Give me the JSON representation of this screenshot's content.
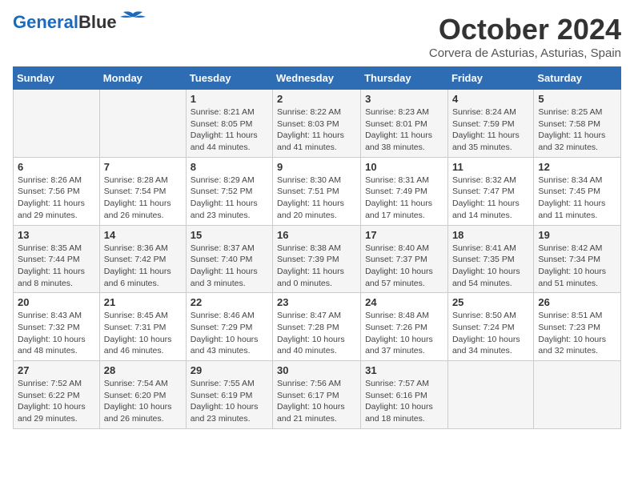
{
  "header": {
    "logo_line1": "General",
    "logo_line2": "Blue",
    "month": "October 2024",
    "location": "Corvera de Asturias, Asturias, Spain"
  },
  "days_of_week": [
    "Sunday",
    "Monday",
    "Tuesday",
    "Wednesday",
    "Thursday",
    "Friday",
    "Saturday"
  ],
  "weeks": [
    [
      {
        "day": "",
        "sunrise": "",
        "sunset": "",
        "daylight": ""
      },
      {
        "day": "",
        "sunrise": "",
        "sunset": "",
        "daylight": ""
      },
      {
        "day": "1",
        "sunrise": "Sunrise: 8:21 AM",
        "sunset": "Sunset: 8:05 PM",
        "daylight": "Daylight: 11 hours and 44 minutes."
      },
      {
        "day": "2",
        "sunrise": "Sunrise: 8:22 AM",
        "sunset": "Sunset: 8:03 PM",
        "daylight": "Daylight: 11 hours and 41 minutes."
      },
      {
        "day": "3",
        "sunrise": "Sunrise: 8:23 AM",
        "sunset": "Sunset: 8:01 PM",
        "daylight": "Daylight: 11 hours and 38 minutes."
      },
      {
        "day": "4",
        "sunrise": "Sunrise: 8:24 AM",
        "sunset": "Sunset: 7:59 PM",
        "daylight": "Daylight: 11 hours and 35 minutes."
      },
      {
        "day": "5",
        "sunrise": "Sunrise: 8:25 AM",
        "sunset": "Sunset: 7:58 PM",
        "daylight": "Daylight: 11 hours and 32 minutes."
      }
    ],
    [
      {
        "day": "6",
        "sunrise": "Sunrise: 8:26 AM",
        "sunset": "Sunset: 7:56 PM",
        "daylight": "Daylight: 11 hours and 29 minutes."
      },
      {
        "day": "7",
        "sunrise": "Sunrise: 8:28 AM",
        "sunset": "Sunset: 7:54 PM",
        "daylight": "Daylight: 11 hours and 26 minutes."
      },
      {
        "day": "8",
        "sunrise": "Sunrise: 8:29 AM",
        "sunset": "Sunset: 7:52 PM",
        "daylight": "Daylight: 11 hours and 23 minutes."
      },
      {
        "day": "9",
        "sunrise": "Sunrise: 8:30 AM",
        "sunset": "Sunset: 7:51 PM",
        "daylight": "Daylight: 11 hours and 20 minutes."
      },
      {
        "day": "10",
        "sunrise": "Sunrise: 8:31 AM",
        "sunset": "Sunset: 7:49 PM",
        "daylight": "Daylight: 11 hours and 17 minutes."
      },
      {
        "day": "11",
        "sunrise": "Sunrise: 8:32 AM",
        "sunset": "Sunset: 7:47 PM",
        "daylight": "Daylight: 11 hours and 14 minutes."
      },
      {
        "day": "12",
        "sunrise": "Sunrise: 8:34 AM",
        "sunset": "Sunset: 7:45 PM",
        "daylight": "Daylight: 11 hours and 11 minutes."
      }
    ],
    [
      {
        "day": "13",
        "sunrise": "Sunrise: 8:35 AM",
        "sunset": "Sunset: 7:44 PM",
        "daylight": "Daylight: 11 hours and 8 minutes."
      },
      {
        "day": "14",
        "sunrise": "Sunrise: 8:36 AM",
        "sunset": "Sunset: 7:42 PM",
        "daylight": "Daylight: 11 hours and 6 minutes."
      },
      {
        "day": "15",
        "sunrise": "Sunrise: 8:37 AM",
        "sunset": "Sunset: 7:40 PM",
        "daylight": "Daylight: 11 hours and 3 minutes."
      },
      {
        "day": "16",
        "sunrise": "Sunrise: 8:38 AM",
        "sunset": "Sunset: 7:39 PM",
        "daylight": "Daylight: 11 hours and 0 minutes."
      },
      {
        "day": "17",
        "sunrise": "Sunrise: 8:40 AM",
        "sunset": "Sunset: 7:37 PM",
        "daylight": "Daylight: 10 hours and 57 minutes."
      },
      {
        "day": "18",
        "sunrise": "Sunrise: 8:41 AM",
        "sunset": "Sunset: 7:35 PM",
        "daylight": "Daylight: 10 hours and 54 minutes."
      },
      {
        "day": "19",
        "sunrise": "Sunrise: 8:42 AM",
        "sunset": "Sunset: 7:34 PM",
        "daylight": "Daylight: 10 hours and 51 minutes."
      }
    ],
    [
      {
        "day": "20",
        "sunrise": "Sunrise: 8:43 AM",
        "sunset": "Sunset: 7:32 PM",
        "daylight": "Daylight: 10 hours and 48 minutes."
      },
      {
        "day": "21",
        "sunrise": "Sunrise: 8:45 AM",
        "sunset": "Sunset: 7:31 PM",
        "daylight": "Daylight: 10 hours and 46 minutes."
      },
      {
        "day": "22",
        "sunrise": "Sunrise: 8:46 AM",
        "sunset": "Sunset: 7:29 PM",
        "daylight": "Daylight: 10 hours and 43 minutes."
      },
      {
        "day": "23",
        "sunrise": "Sunrise: 8:47 AM",
        "sunset": "Sunset: 7:28 PM",
        "daylight": "Daylight: 10 hours and 40 minutes."
      },
      {
        "day": "24",
        "sunrise": "Sunrise: 8:48 AM",
        "sunset": "Sunset: 7:26 PM",
        "daylight": "Daylight: 10 hours and 37 minutes."
      },
      {
        "day": "25",
        "sunrise": "Sunrise: 8:50 AM",
        "sunset": "Sunset: 7:24 PM",
        "daylight": "Daylight: 10 hours and 34 minutes."
      },
      {
        "day": "26",
        "sunrise": "Sunrise: 8:51 AM",
        "sunset": "Sunset: 7:23 PM",
        "daylight": "Daylight: 10 hours and 32 minutes."
      }
    ],
    [
      {
        "day": "27",
        "sunrise": "Sunrise: 7:52 AM",
        "sunset": "Sunset: 6:22 PM",
        "daylight": "Daylight: 10 hours and 29 minutes."
      },
      {
        "day": "28",
        "sunrise": "Sunrise: 7:54 AM",
        "sunset": "Sunset: 6:20 PM",
        "daylight": "Daylight: 10 hours and 26 minutes."
      },
      {
        "day": "29",
        "sunrise": "Sunrise: 7:55 AM",
        "sunset": "Sunset: 6:19 PM",
        "daylight": "Daylight: 10 hours and 23 minutes."
      },
      {
        "day": "30",
        "sunrise": "Sunrise: 7:56 AM",
        "sunset": "Sunset: 6:17 PM",
        "daylight": "Daylight: 10 hours and 21 minutes."
      },
      {
        "day": "31",
        "sunrise": "Sunrise: 7:57 AM",
        "sunset": "Sunset: 6:16 PM",
        "daylight": "Daylight: 10 hours and 18 minutes."
      },
      {
        "day": "",
        "sunrise": "",
        "sunset": "",
        "daylight": ""
      },
      {
        "day": "",
        "sunrise": "",
        "sunset": "",
        "daylight": ""
      }
    ]
  ]
}
